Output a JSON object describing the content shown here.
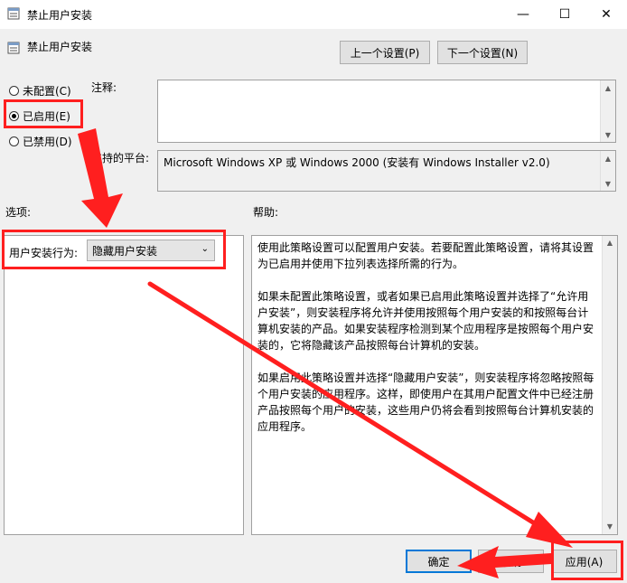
{
  "window": {
    "title": "禁止用户安装",
    "controls": {
      "minimize": "—",
      "maximize": "☐",
      "close": "✕"
    }
  },
  "header": {
    "policy_name": "禁止用户安装",
    "prev_button": "上一个设置(P)",
    "next_button": "下一个设置(N)"
  },
  "state": {
    "options": [
      {
        "label": "未配置(C)",
        "checked": false
      },
      {
        "label": "已启用(E)",
        "checked": true
      },
      {
        "label": "已禁用(D)",
        "checked": false
      }
    ]
  },
  "comment": {
    "label": "注释:",
    "value": ""
  },
  "platform": {
    "label": "支持的平台:",
    "value": "Microsoft Windows XP 或 Windows 2000 (安装有 Windows Installer v2.0)"
  },
  "options_section": {
    "label": "选项:",
    "install_behavior_label": "用户安装行为:",
    "install_behavior_value": "隐藏用户安装"
  },
  "help_section": {
    "label": "帮助:",
    "paragraphs": [
      "使用此策略设置可以配置用户安装。若要配置此策略设置，请将其设置为已启用并使用下拉列表选择所需的行为。",
      "如果未配置此策略设置，或者如果已启用此策略设置并选择了“允许用户安装”，则安装程序将允许并使用按照每个用户安装的和按照每台计算机安装的产品。如果安装程序检测到某个应用程序是按照每个用户安装的，它将隐藏该产品按照每台计算机的安装。",
      "如果启用此策略设置并选择“隐藏用户安装”，则安装程序将忽略按照每个用户安装的应用程序。这样，即使用户在其用户配置文件中已经注册产品按照每个用户的安装，这些用户仍将会看到按照每台计算机安装的应用程序。"
    ]
  },
  "footer": {
    "ok": "确定",
    "cancel": "取消",
    "apply": "应用(A)"
  },
  "colors": {
    "annotation": "#ff1f1f",
    "accent": "#0078d7"
  }
}
